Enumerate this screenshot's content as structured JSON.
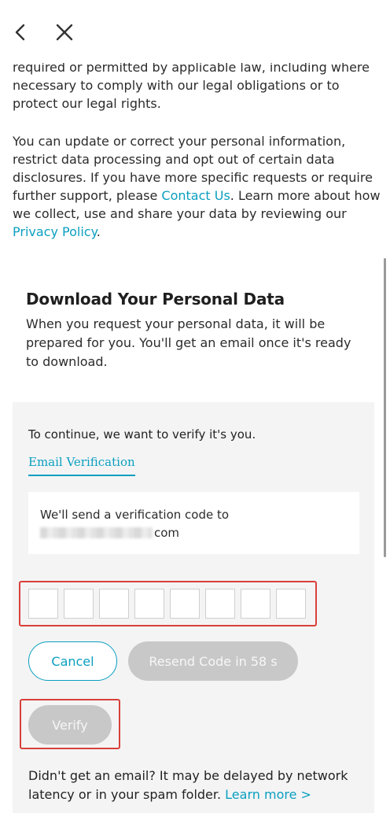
{
  "nav": {
    "back_icon": "chevron-left-icon",
    "close_icon": "close-icon"
  },
  "policy": {
    "paragraph1": "required or permitted by applicable law, including where necessary to comply with our legal obligations or to protect our legal rights.",
    "paragraph2_before": "You can update or correct your personal information, restrict data processing and opt out of certain data disclosures. If you have more specific requests or require further support, please ",
    "contact_link": "Contact Us",
    "paragraph2_middle": ". Learn more about how we collect, use and share your data by reviewing our ",
    "privacy_link": "Privacy Policy",
    "paragraph2_end": "."
  },
  "download": {
    "title": "Download Your Personal Data",
    "description": "When you request your personal data, it will be prepared for you. You'll get an email once it's ready to download."
  },
  "verification": {
    "intro": "To continue, we want to verify it's you.",
    "tab_label": "Email Verification",
    "send_text": "We'll send a verification code to",
    "email_suffix": "com",
    "code_length": 8,
    "cancel_label": "Cancel",
    "resend_label": "Resend Code in 58 s",
    "verify_label": "Verify",
    "help_text": "Didn't get an email? It may be delayed by network latency or in your spam folder. ",
    "learn_more_label": "Learn more >"
  },
  "colors": {
    "accent": "#0a9fbf",
    "highlight": "#d9403a",
    "disabled_button": "#c8c8c8",
    "panel_bg": "#f4f4f5"
  }
}
